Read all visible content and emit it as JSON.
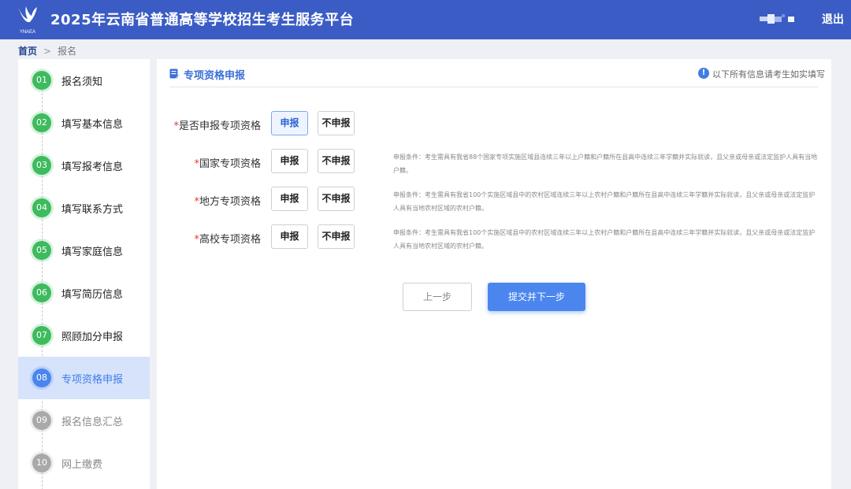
{
  "header": {
    "logo_text": "YNAEA",
    "title": "2025年云南省普通高等学校招生考生服务平台",
    "logout_label": "退出",
    "bg_color": "#3a5cc4"
  },
  "breadcrumb": {
    "home": "首页",
    "separator": ">",
    "current": "报名"
  },
  "sidebar": {
    "steps": [
      {
        "num": "01",
        "label": "报名须知",
        "state": "done"
      },
      {
        "num": "02",
        "label": "填写基本信息",
        "state": "done"
      },
      {
        "num": "03",
        "label": "填写报考信息",
        "state": "done"
      },
      {
        "num": "04",
        "label": "填写联系方式",
        "state": "done"
      },
      {
        "num": "05",
        "label": "填写家庭信息",
        "state": "done"
      },
      {
        "num": "06",
        "label": "填写简历信息",
        "state": "done"
      },
      {
        "num": "07",
        "label": "照顾加分申报",
        "state": "done"
      },
      {
        "num": "08",
        "label": "专项资格申报",
        "state": "active"
      },
      {
        "num": "09",
        "label": "报名信息汇总",
        "state": "todo"
      },
      {
        "num": "10",
        "label": "网上缴费",
        "state": "todo"
      }
    ],
    "colors": {
      "done": "#3dbb5d",
      "active": "#4a86ee",
      "todo": "#a9a9a9"
    }
  },
  "main": {
    "section_title": "专项资格申报",
    "notice": "以下所有信息请考生如实填写",
    "required_mark": "*",
    "questions": [
      {
        "label": "是否申报专项资格",
        "yes": "申报",
        "no": "不申报",
        "selected": "yes",
        "condition": ""
      },
      {
        "label": "国家专项资格",
        "yes": "申报",
        "no": "不申报",
        "selected": "",
        "condition": "申报条件：考生需具有我省88个国家专项实施区域县连续三年以上户籍和户籍所在县高中连续三年学籍并实际就读，且父亲或母亲或法定监护人具有当地户籍。"
      },
      {
        "label": "地方专项资格",
        "yes": "申报",
        "no": "不申报",
        "selected": "",
        "condition": "申报条件：考生需具有我省100个实施区域县中的农村区域连续三年以上农村户籍和户籍所在县高中连续三年学籍并实际就读，且父亲或母亲或法定监护人具有当地农村区域的农村户籍。"
      },
      {
        "label": "高校专项资格",
        "yes": "申报",
        "no": "不申报",
        "selected": "",
        "condition": "申报条件：考生需具有我省100个实施区域县中的农村区域连续三年以上农村户籍和户籍所在县高中连续三年学籍并实际就读，且父亲或母亲或法定监护人具有当地农村区域的农村户籍。"
      }
    ],
    "prev_label": "上一步",
    "next_label": "提交并下一步",
    "accent_color": "#4a86ee"
  }
}
